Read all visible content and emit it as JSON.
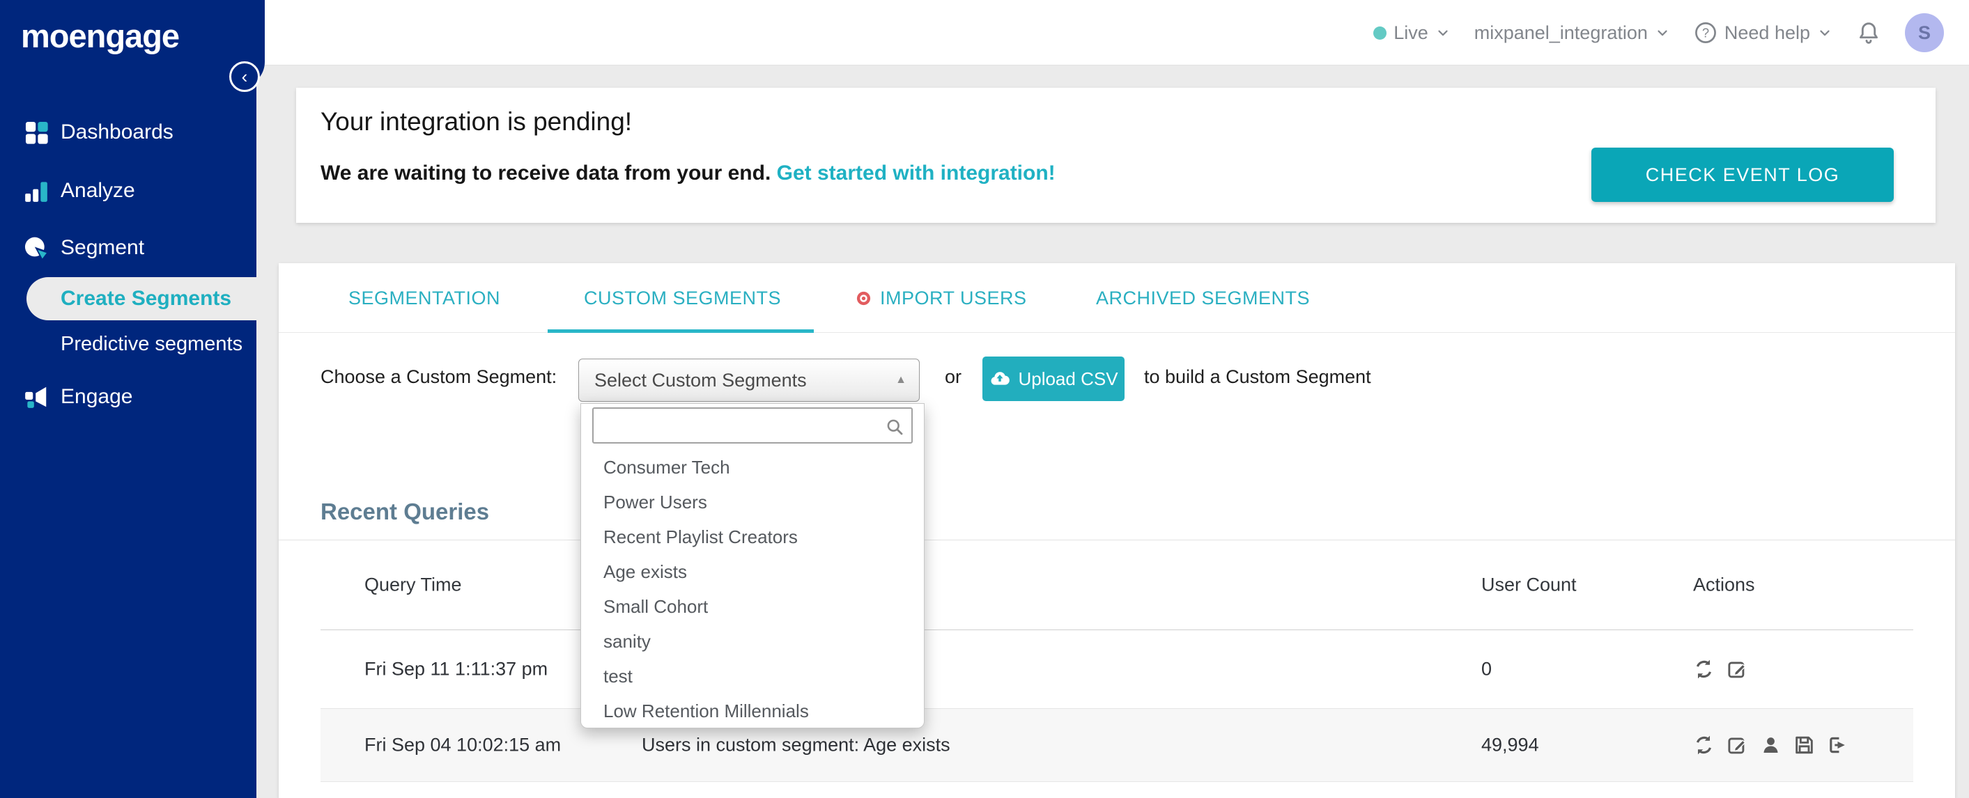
{
  "colors": {
    "navy": "#00267d",
    "accent_teal": "#1fafc0",
    "check_log_button_teal": "#0aa6b7",
    "upload_button_teal": "#22aebe",
    "live_dot_teal": "#63cac4",
    "import_badge_red": "#e25c5f",
    "heading_slate": "#5e7d92",
    "avatar_bg": "#b3b8ef",
    "page_bg": "#ebebeb"
  },
  "sidebar": {
    "logo_text": "moengage",
    "items": [
      {
        "label": "Dashboards"
      },
      {
        "label": "Analyze"
      },
      {
        "label": "Segment"
      },
      {
        "label": "Create Segments",
        "active": true
      },
      {
        "label": "Predictive segments"
      },
      {
        "label": "Engage"
      }
    ]
  },
  "header": {
    "environment_label": "Live",
    "project_name": "mixpanel_integration",
    "help_label": "Need help",
    "avatar_initial": "S"
  },
  "banner": {
    "title": "Your integration is pending!",
    "subtitle": "We are waiting to receive data from your end.",
    "link_text": "Get started with integration!",
    "button_label": "CHECK EVENT LOG"
  },
  "tabs": [
    {
      "label": "SEGMENTATION"
    },
    {
      "label": "CUSTOM SEGMENTS",
      "active": true
    },
    {
      "label": "IMPORT USERS",
      "has_badge": true
    },
    {
      "label": "ARCHIVED SEGMENTS"
    }
  ],
  "segment_picker": {
    "label": "Choose a Custom Segment:",
    "select_value": "Select Custom Segments",
    "or_text": "or",
    "upload_button_label": "Upload CSV",
    "suffix_text": "to build a Custom Segment",
    "search_value": "",
    "options": [
      "Consumer Tech",
      "Power Users",
      "Recent Playlist Creators",
      "Age exists",
      "Small Cohort",
      "sanity",
      "test",
      "Low Retention Millennials"
    ]
  },
  "recent_queries": {
    "heading": "Recent Queries",
    "table": {
      "headers": {
        "query_time": "Query Time",
        "user_count": "User Count",
        "actions": "Actions"
      },
      "rows": [
        {
          "query_time": "Fri Sep 11 1:11:37 pm",
          "description": "",
          "user_count": "0"
        },
        {
          "query_time": "Fri Sep 04 10:02:15 am",
          "description": "Users in custom segment: Age exists",
          "user_count": "49,994"
        }
      ]
    }
  }
}
